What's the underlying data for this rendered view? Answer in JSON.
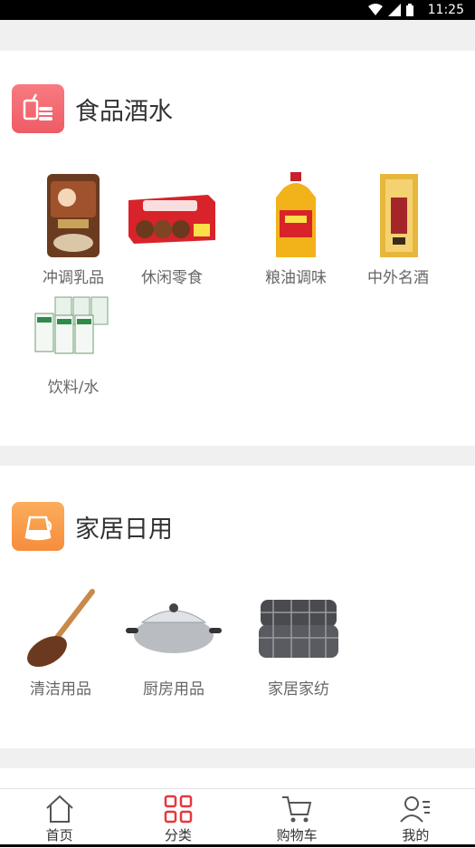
{
  "status_bar": {
    "time": "11:25"
  },
  "sections": [
    {
      "title": "食品酒水",
      "icon": "drink-food-icon",
      "accent": "#f0646e",
      "items": [
        {
          "label": "冲调乳品",
          "image": "coffee-pack-image"
        },
        {
          "label": "休闲零食",
          "image": "snack-box-image"
        },
        {
          "label": "粮油调味",
          "image": "oil-bottle-image"
        },
        {
          "label": "中外名酒",
          "image": "liquor-box-image"
        },
        {
          "label": "饮料/水",
          "image": "drink-cartons-image"
        }
      ]
    },
    {
      "title": "家居日用",
      "icon": "kettle-icon",
      "accent": "#f99b4a",
      "items": [
        {
          "label": "清洁用品",
          "image": "brush-image"
        },
        {
          "label": "厨房用品",
          "image": "wok-image"
        },
        {
          "label": "家居家纺",
          "image": "quilt-image"
        }
      ]
    }
  ],
  "tabbar": {
    "tabs": [
      {
        "label": "首页",
        "icon": "home-icon"
      },
      {
        "label": "分类",
        "icon": "category-grid-icon",
        "active": true
      },
      {
        "label": "购物车",
        "icon": "cart-icon"
      },
      {
        "label": "我的",
        "icon": "profile-icon"
      }
    ],
    "active_color": "#e5383b"
  }
}
